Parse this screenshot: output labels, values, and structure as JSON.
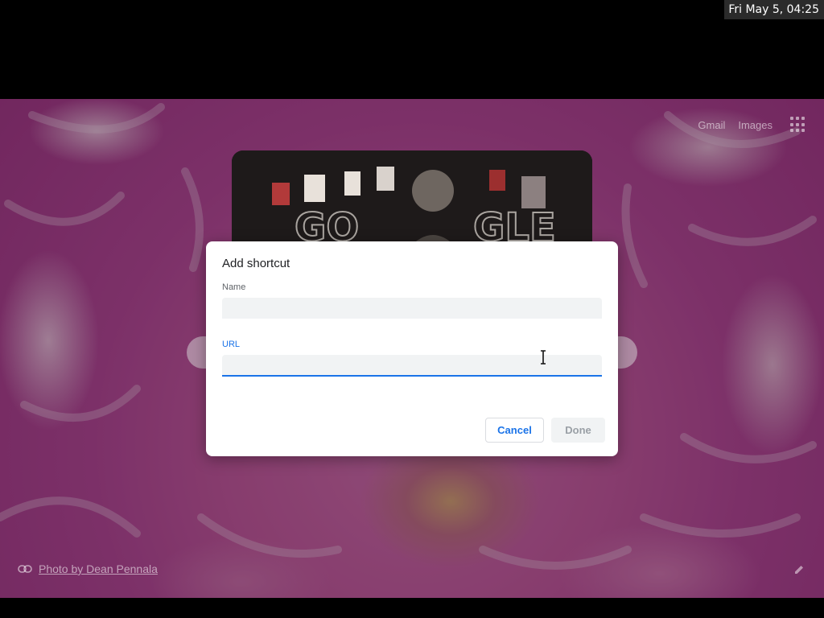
{
  "system": {
    "clock": "Fri May  5, 04:25"
  },
  "header": {
    "gmail": "Gmail",
    "images": "Images"
  },
  "footer": {
    "photo_credit": "Photo by Dean Pennala"
  },
  "dialog": {
    "title": "Add shortcut",
    "name_label": "Name",
    "name_value": "",
    "url_label": "URL",
    "url_value": "",
    "cancel_label": "Cancel",
    "done_label": "Done"
  },
  "colors": {
    "accent": "#1a73e8",
    "dialog_bg": "#ffffff",
    "field_bg": "#f1f3f4"
  }
}
